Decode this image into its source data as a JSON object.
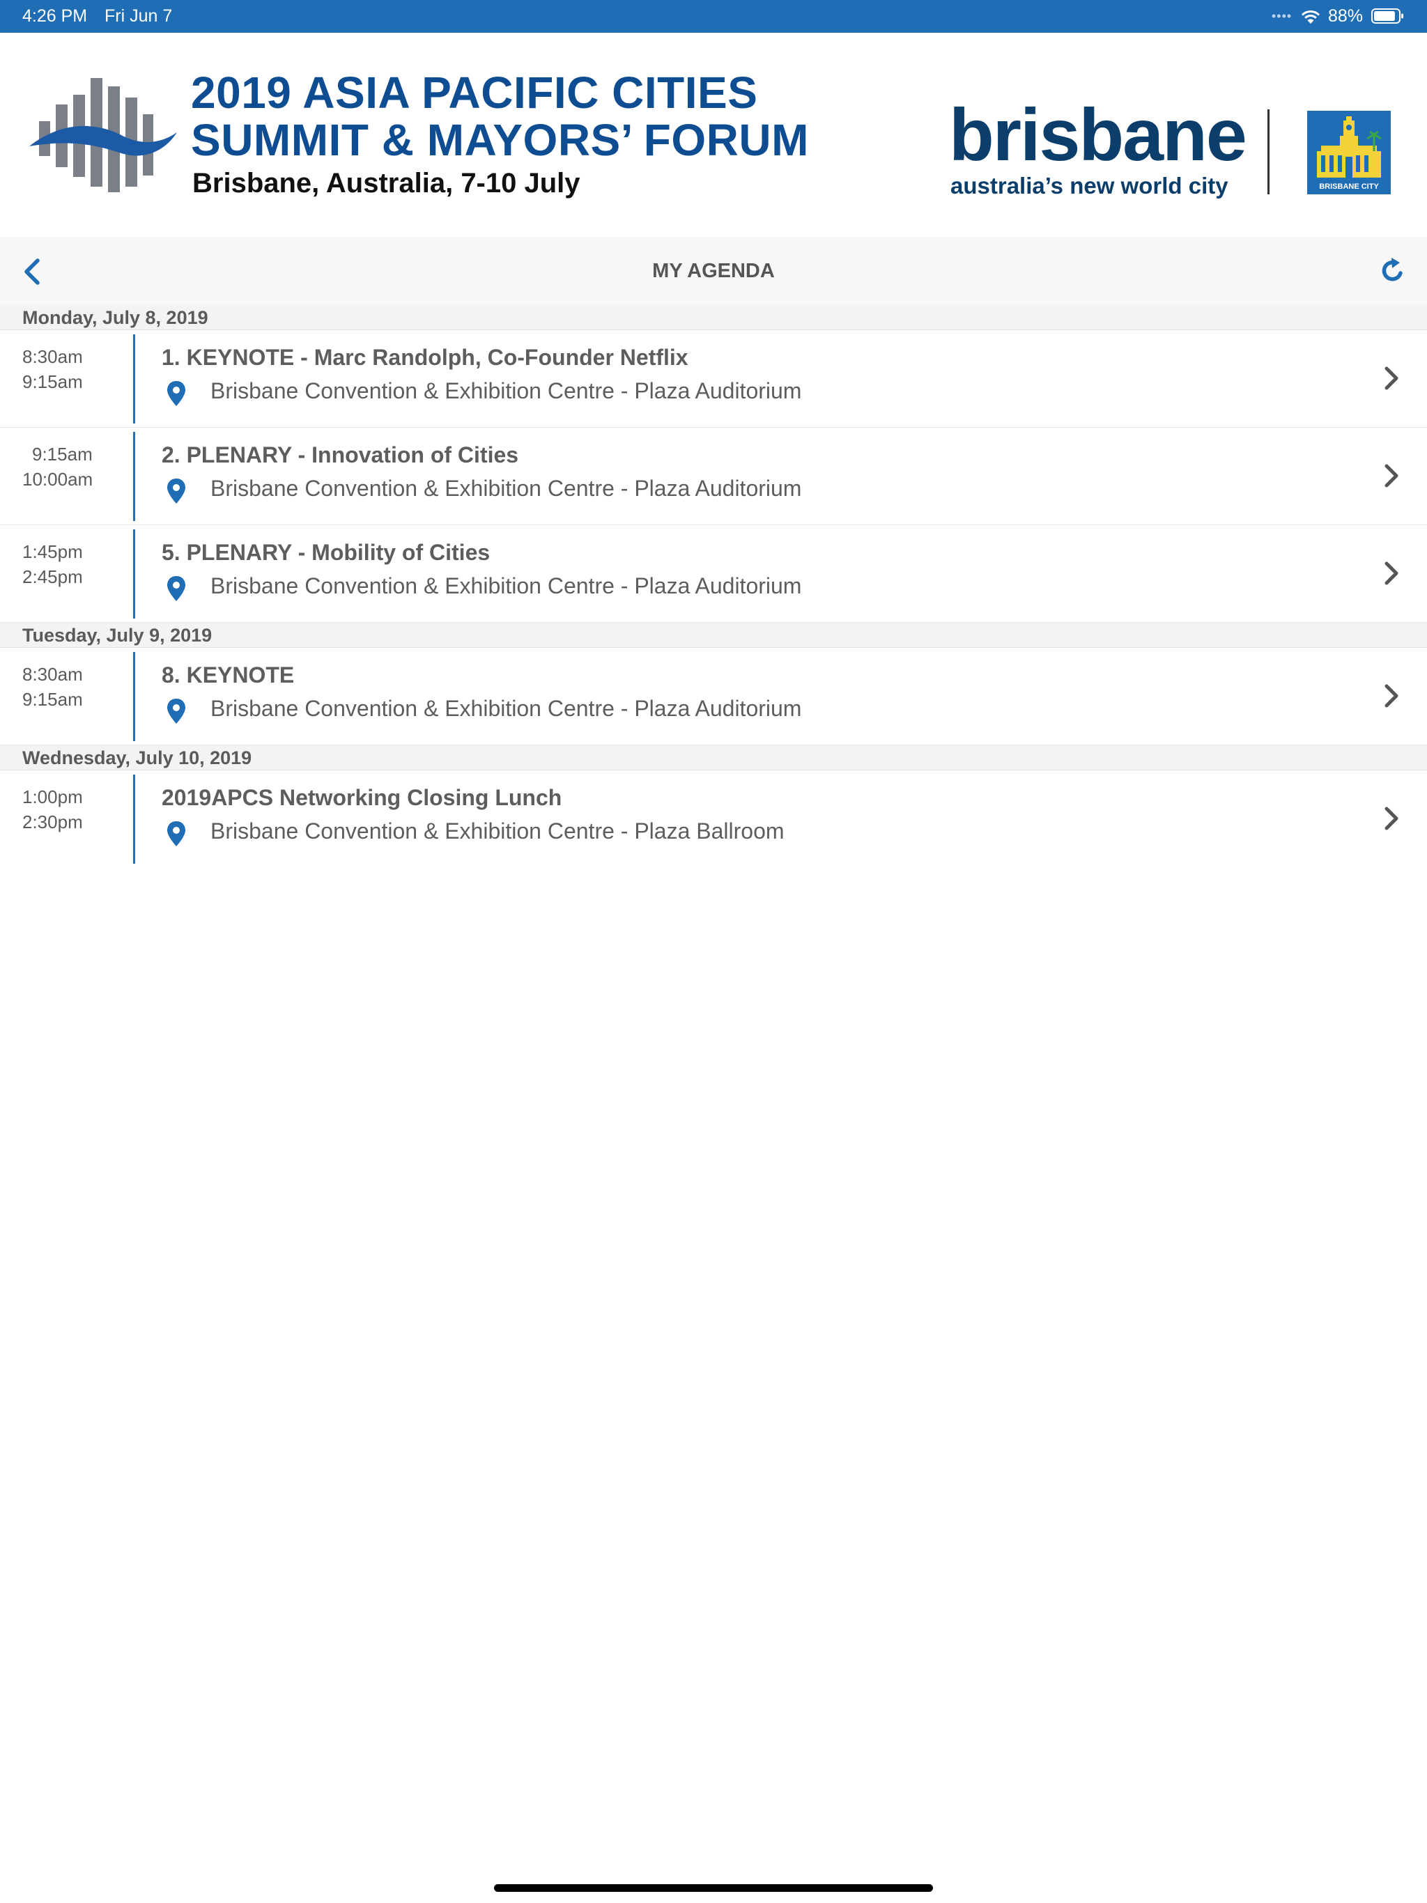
{
  "status_bar": {
    "time": "4:26 PM",
    "date": "Fri Jun 7",
    "battery_percent": "88%",
    "battery_level": 0.88,
    "signal_dots": "••••"
  },
  "header": {
    "event_title_line1": "2019 ASIA PACIFIC CITIES",
    "event_title_line2": "SUMMIT & MAYORS’ FORUM",
    "event_subtitle": "Brisbane, Australia, 7-10 July",
    "brisbane_wordmark": "brisbane",
    "brisbane_tagline": "australia’s new world city",
    "crest_caption": "BRISBANE CITY"
  },
  "nav": {
    "title": "MY AGENDA",
    "back_icon": "chevron-left-icon",
    "refresh_icon": "refresh-icon"
  },
  "colors": {
    "status_bar": "#1f6db4",
    "accent": "#2a6cb0",
    "title_blue": "#0e4d92",
    "text": "#5d5d5d",
    "section_bg": "#f3f3f3"
  },
  "days": [
    {
      "label": "Monday, July 8, 2019",
      "sessions": [
        {
          "start": "8:30am",
          "end": "9:15am",
          "title": "1. KEYNOTE - Marc Randolph, Co-Founder Netflix",
          "location": "Brisbane Convention & Exhibition Centre - Plaza Auditorium"
        },
        {
          "start": "9:15am",
          "end": "10:00am",
          "title": "2. PLENARY - Innovation of Cities",
          "location": "Brisbane Convention & Exhibition Centre - Plaza Auditorium"
        },
        {
          "start": "1:45pm",
          "end": "2:45pm",
          "title": "5. PLENARY - Mobility of Cities",
          "location": "Brisbane Convention & Exhibition Centre - Plaza Auditorium"
        }
      ]
    },
    {
      "label": "Tuesday, July 9, 2019",
      "sessions": [
        {
          "start": "8:30am",
          "end": "9:15am",
          "title": "8. KEYNOTE",
          "location": "Brisbane Convention & Exhibition Centre - Plaza Auditorium"
        }
      ]
    },
    {
      "label": "Wednesday, July 10, 2019",
      "sessions": [
        {
          "start": "1:00pm",
          "end": "2:30pm",
          "title": "2019APCS Networking Closing Lunch",
          "location": "Brisbane Convention & Exhibition Centre - Plaza Ballroom"
        }
      ]
    }
  ]
}
